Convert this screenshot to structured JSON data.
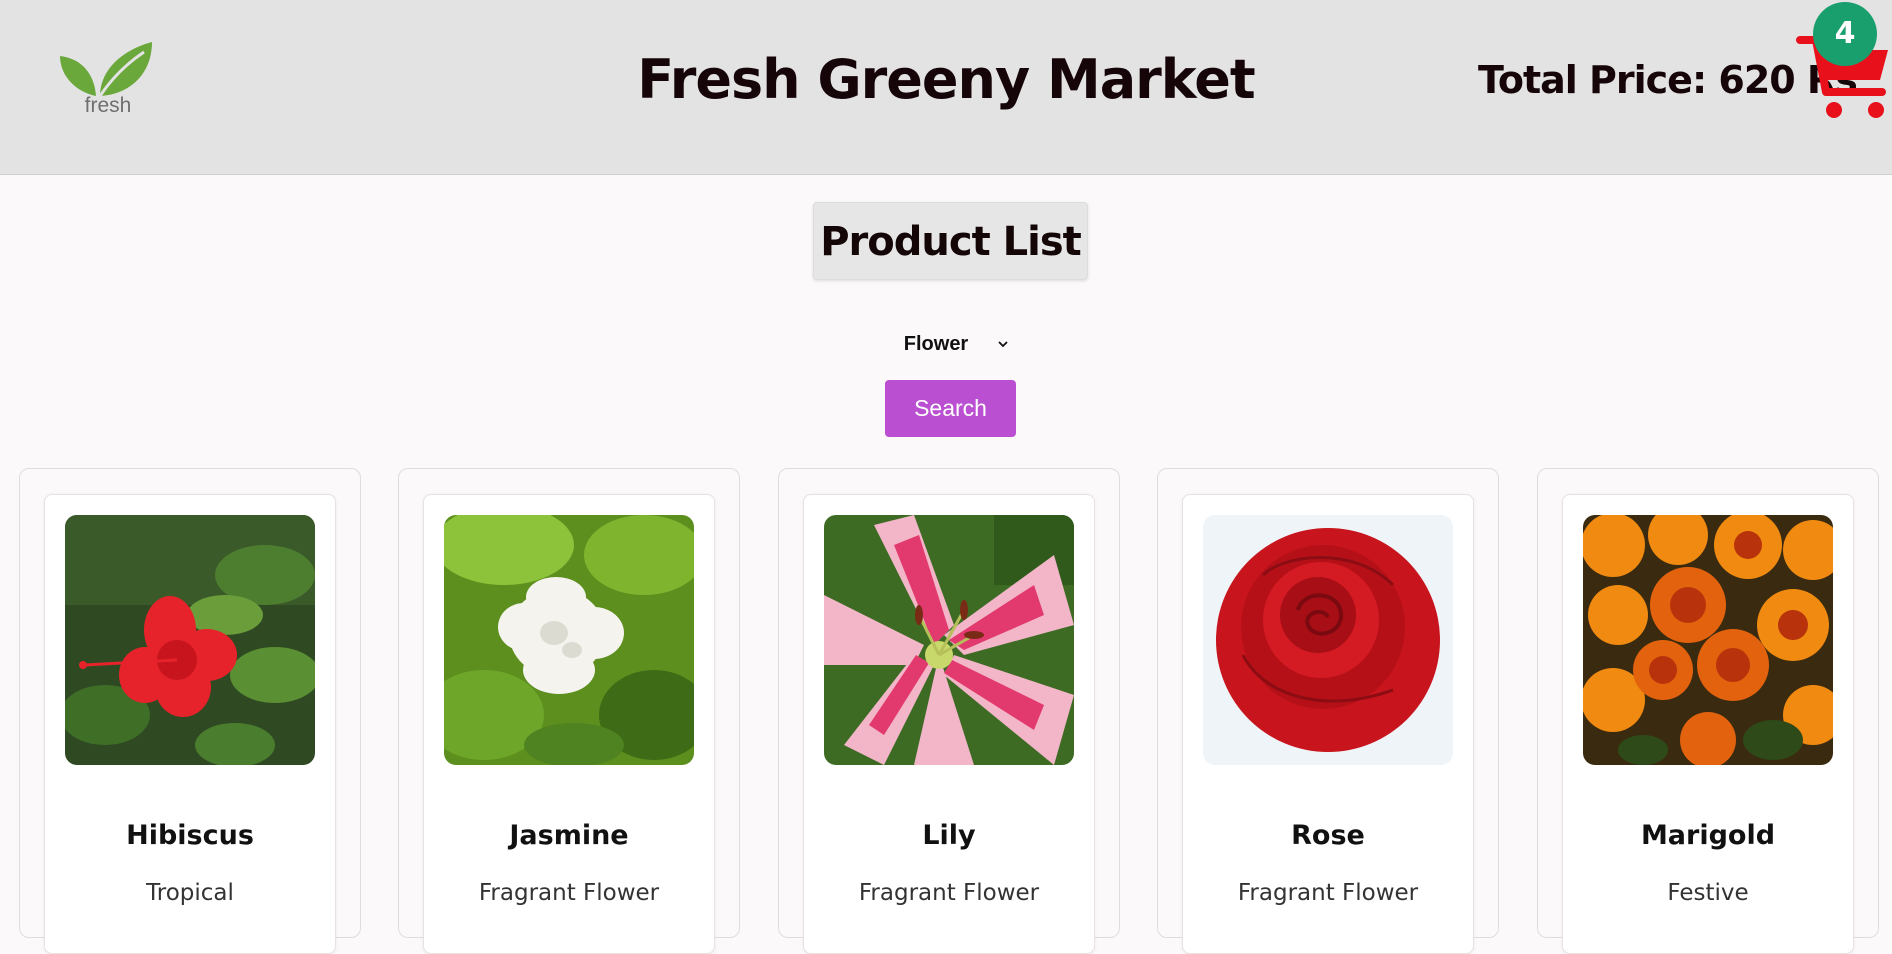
{
  "header": {
    "logo_text": "fresh",
    "title": "Fresh Greeny Market",
    "total_price": "Total Price: 620 Rs",
    "cart_count": "4"
  },
  "main": {
    "heading": "Product List",
    "category_select": {
      "selected": "Flower"
    },
    "search_label": "Search"
  },
  "products": [
    {
      "name": "Hibiscus",
      "description": "Tropical",
      "image": "hibiscus"
    },
    {
      "name": "Jasmine",
      "description": "Fragrant Flower",
      "image": "jasmine"
    },
    {
      "name": "Lily",
      "description": "Fragrant Flower",
      "image": "lily"
    },
    {
      "name": "Rose",
      "description": "Fragrant Flower",
      "image": "rose"
    },
    {
      "name": "Marigold",
      "description": "Festive",
      "image": "marigold"
    }
  ],
  "colors": {
    "header_bg": "#e4e3e4",
    "search_button": "#bb4fd2",
    "cart_icon": "#e8101b",
    "cart_badge": "#199f6d"
  }
}
